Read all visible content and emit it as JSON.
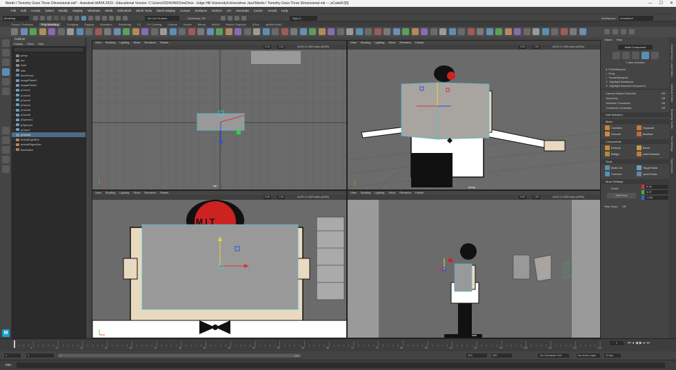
{
  "window": {
    "title": "Martin I Tomothy Goes Three Dimensional.mb* - Autodesk MAYA 2023 - Educational Version: C:\\Users\\25242460\\OneDrive - Edge Hill University\\Universitree Jazz\\Martin I Tomothy Goes Three Dimensional.mb --- pCube8.f[3]",
    "minimize": "—",
    "maximize": "☐",
    "close": "✕"
  },
  "menubar": [
    "File",
    "Edit",
    "Create",
    "Select",
    "Modify",
    "Display",
    "Windows",
    "Mesh",
    "Edit Mesh",
    "Mesh Tools",
    "Mesh Display",
    "Curves",
    "Surfaces",
    "Deform",
    "UV",
    "Generate",
    "Cache",
    "Arnold",
    "Help"
  ],
  "statusline": {
    "mode": "Modeling",
    "live_surface": "No Live Surface",
    "symmetry": "Symmetry: Off",
    "sign_in": "Sign In",
    "workspace_label": "Workspace:",
    "workspace_value": "Animation*"
  },
  "shelf_tabs": [
    "Curves / Surfaces",
    "Poly Modeling",
    "Sculpting",
    "Rigging",
    "Animation",
    "Rendering",
    "FX",
    "FX Caching",
    "Custom",
    "Arnold",
    "Bifrost",
    "MASH",
    "Motion Graphics",
    "XGen",
    "ngSkinTools2"
  ],
  "shelf_active": "Poly Modeling",
  "outliner": {
    "title": "Outliner",
    "menu": [
      "Display",
      "Show",
      "Help"
    ],
    "items": [
      {
        "label": "persp",
        "type": "camera"
      },
      {
        "label": "top",
        "type": "camera"
      },
      {
        "label": "front",
        "type": "camera"
      },
      {
        "label": "side",
        "type": "camera"
      },
      {
        "label": "bluePencil",
        "type": "pencil"
      },
      {
        "label": "imagePlane2",
        "type": "image"
      },
      {
        "label": "imagePlane1",
        "type": "image"
      },
      {
        "label": "pCube1",
        "type": "mesh"
      },
      {
        "label": "pCube2",
        "type": "mesh"
      },
      {
        "label": "pCube3",
        "type": "mesh"
      },
      {
        "label": "pCube4",
        "type": "mesh"
      },
      {
        "label": "pCube5",
        "type": "mesh"
      },
      {
        "label": "pCube6",
        "type": "mesh"
      },
      {
        "label": "pSphere1",
        "type": "mesh"
      },
      {
        "label": "pSphere2",
        "type": "mesh"
      },
      {
        "label": "pCube7",
        "type": "mesh"
      },
      {
        "label": "pCube8",
        "type": "mesh",
        "selected": true
      },
      {
        "label": "defaultLightSet",
        "type": "set"
      },
      {
        "label": "defaultObjectSet",
        "type": "set"
      },
      {
        "label": "timeEditor",
        "type": "time"
      }
    ]
  },
  "viewport_menu": [
    "View",
    "Shading",
    "Lighting",
    "Show",
    "Renderer",
    "Panels"
  ],
  "viewports": [
    {
      "name": "top",
      "label": "top",
      "near": "0.00",
      "far": "1.00",
      "color_space": "ACES 1.0 SDR-video (sRGB)"
    },
    {
      "name": "persp",
      "label": "persp",
      "near": "0.00",
      "far": "1.00",
      "color_space": "ACES 1.0 SDR-video (sRGB)"
    },
    {
      "name": "front",
      "label": "front",
      "near": "0.00",
      "far": "1.00",
      "color_space": "ACES 1.0 SDR-video (sRGB)"
    },
    {
      "name": "side",
      "label": "side",
      "near": "0.00",
      "far": "1.00",
      "color_space": "ACES 1.0 SDR-video (sRGB)"
    }
  ],
  "face_text": "M I T",
  "attr_panel": {
    "menu": [
      "Object",
      "Help"
    ],
    "mode_button": "Multi-Component",
    "selection_info": "1 face selected",
    "options": [
      {
        "label": "Pick/Marquee",
        "checked": true,
        "type": "radio"
      },
      {
        "label": "Drag",
        "checked": false,
        "type": "radio"
      },
      {
        "label": "Tweak/Marquee",
        "checked": false,
        "type": "radio"
      },
      {
        "label": "Highlight Backfaces",
        "checked": true,
        "type": "check"
      },
      {
        "label": "Highlight Nearest Component",
        "checked": true,
        "type": "check"
      }
    ],
    "camera_selection": "Camera Based Selection",
    "camera_selection_value": "Off",
    "symmetry_label": "Symmetry",
    "symmetry_value": "Off",
    "selection_constraint": "Selection Constraint",
    "selection_constraint_value": "Off",
    "transform_constraint": "Transform Constraint",
    "transform_constraint_value": "Off",
    "soft_selection": "Soft Selection",
    "mesh_header": "Mesh",
    "mesh_buttons": [
      "Combine",
      "Separate",
      "Smooth",
      "Boolean"
    ],
    "components_header": "Components",
    "components_buttons": [
      "Extrude",
      "Bevel",
      "Bridge",
      "Add Divisions"
    ],
    "tools_header": "Tools",
    "tools_buttons": [
      "Multi-Cut",
      "Target Weld",
      "Connect",
      "Quad Draw"
    ],
    "move_header": "Move Settings",
    "move_space": "World",
    "move_x": "0.16",
    "move_y": "5.27",
    "move_z": "-0.65",
    "edit_pivot": "Edit Pivot",
    "step_snap": "Step Snap:",
    "step_snap_value": "Off"
  },
  "side_tabs": [
    "Channel Box / Layer Editor",
    "Attribute Editor",
    "Modeling Toolkit",
    "Tool Settings",
    "Hypershade"
  ],
  "timeline": {
    "ticks": [
      "5",
      "10",
      "15",
      "20",
      "25",
      "30",
      "35",
      "40",
      "45",
      "50",
      "55",
      "60",
      "65",
      "70",
      "75",
      "80",
      "85",
      "90",
      "95",
      "100",
      "105",
      "110",
      "115",
      "120"
    ],
    "current_frame": "1"
  },
  "range": {
    "start": "1",
    "start2": "1",
    "range_start": "1",
    "range_end": "120",
    "end": "120",
    "end2": "200",
    "character_set": "No Character Set",
    "anim_layer": "No Anim Layer",
    "fps": "24 fps"
  },
  "cmdline": {
    "lang": "MEL"
  },
  "colors": {
    "accent": "#5a8fb4",
    "selection": "#4d6b85",
    "manip_x": "#e03030",
    "manip_y": "#e8d830",
    "manip_z": "#3050e0"
  }
}
